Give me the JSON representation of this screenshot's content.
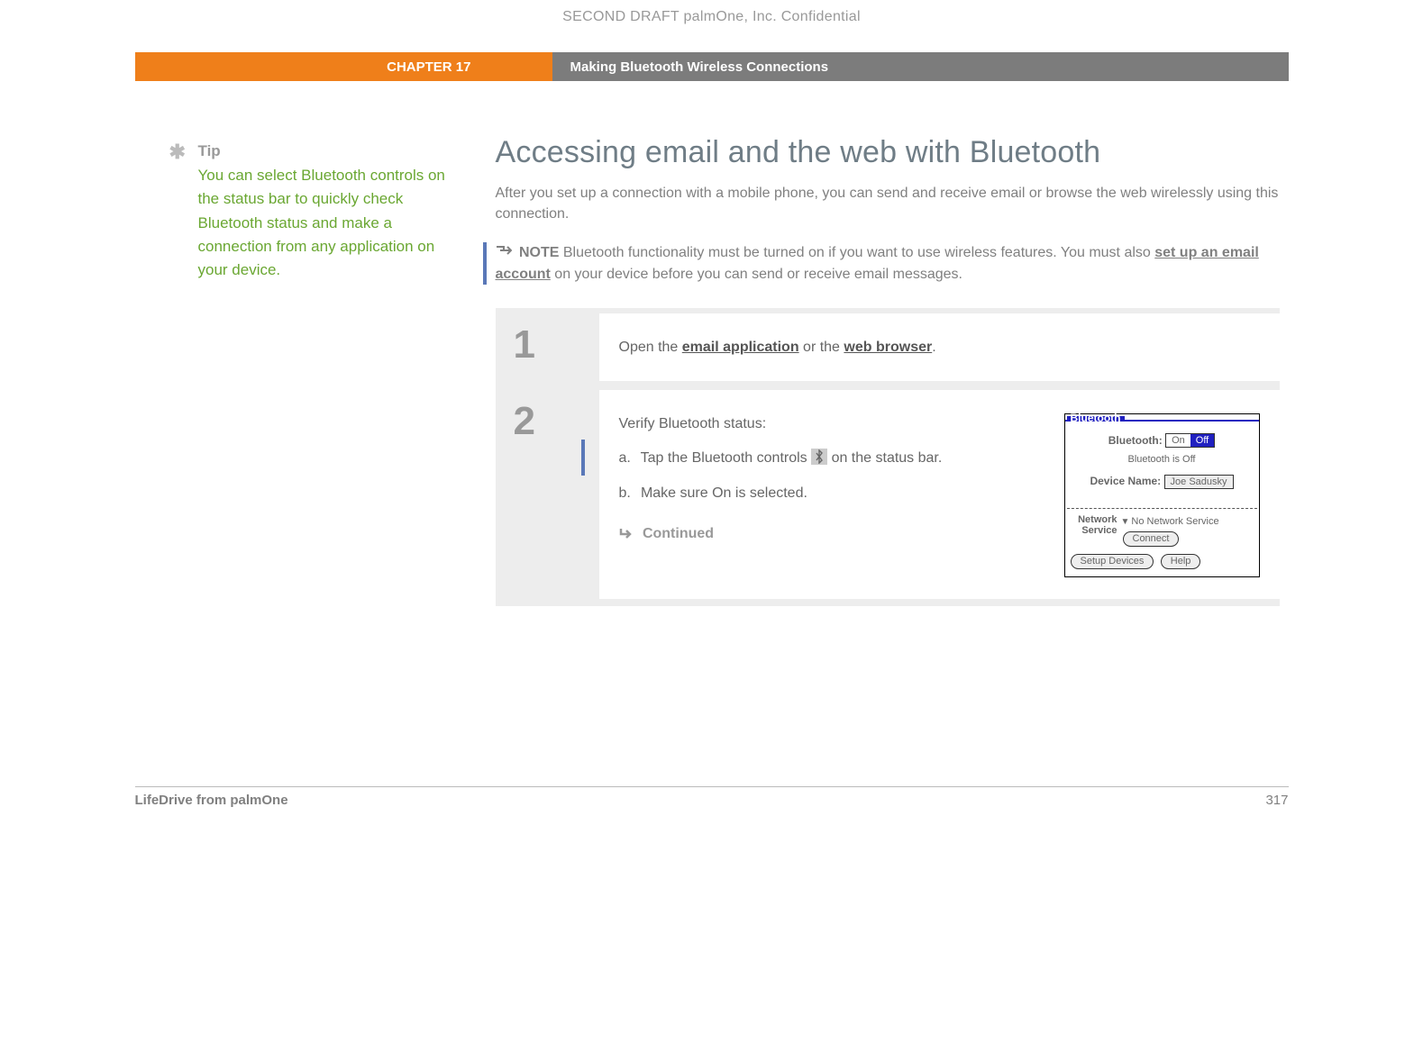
{
  "draft_header": "SECOND DRAFT palmOne, Inc.  Confidential",
  "topbar": {
    "chapter": "CHAPTER 17",
    "title": "Making Bluetooth Wireless Connections"
  },
  "tip": {
    "asterisk": "✱",
    "label": "Tip",
    "text": "You can select Bluetooth controls on the status bar to quickly check Bluetooth status and make a connection from any application on your device."
  },
  "heading": "Accessing email and the web with Bluetooth",
  "intro": "After you set up a connection with a mobile phone, you can send and receive email or browse the web wirelessly using this connection.",
  "note": {
    "label": "NOTE",
    "before_link": "Bluetooth functionality must be turned on if you want to use wireless features. You must also ",
    "link": "set up an email account",
    "after_link": " on your device before you can send or receive email messages."
  },
  "steps": [
    {
      "num": "1",
      "line_before": "Open the ",
      "link1": "email application",
      "mid": " or the ",
      "link2": "web browser",
      "line_after": "."
    },
    {
      "num": "2",
      "intro": "Verify Bluetooth status:",
      "a_text": "Tap the Bluetooth controls ",
      "a_tail": " on the status bar.",
      "b_text": "Make sure On is selected.",
      "continued": "Continued"
    }
  ],
  "device": {
    "title": "Bluetooth",
    "bt_label": "Bluetooth:",
    "toggle_on": "On",
    "toggle_off": "Off",
    "status": "Bluetooth is Off",
    "devname_label": "Device Name:",
    "devname_value": "Joe Sadusky",
    "net_label_l1": "Network",
    "net_label_l2": "Service",
    "net_value": "No Network Service",
    "connect_btn": "Connect",
    "setup_btn": "Setup Devices",
    "help_btn": "Help"
  },
  "footer": {
    "product": "LifeDrive from palmOne",
    "page": "317"
  }
}
